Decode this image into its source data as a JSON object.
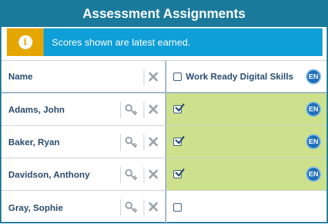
{
  "title": "Assessment Assignments",
  "alert": {
    "icon": "info-icon",
    "text": "Scores shown are latest earned."
  },
  "header": {
    "name_label": "Name",
    "assessment_label": "Work Ready Digital Skills",
    "lang_badge": "EN"
  },
  "rows": [
    {
      "name": "Adams, John",
      "checked": true,
      "earned": true,
      "lang_badge": "EN"
    },
    {
      "name": "Baker, Ryan",
      "checked": true,
      "earned": true,
      "lang_badge": "EN"
    },
    {
      "name": "Davidson, Anthony",
      "checked": true,
      "earned": true,
      "lang_badge": "EN"
    },
    {
      "name": "Gray, Sophie",
      "checked": false,
      "earned": false,
      "lang_badge": ""
    }
  ],
  "colors": {
    "header": "#1b7a9c",
    "alert": "#0e9ed8",
    "alert_icon_bg": "#e6a600",
    "earned": "#cde18c",
    "badge": "#1e6fb8"
  }
}
